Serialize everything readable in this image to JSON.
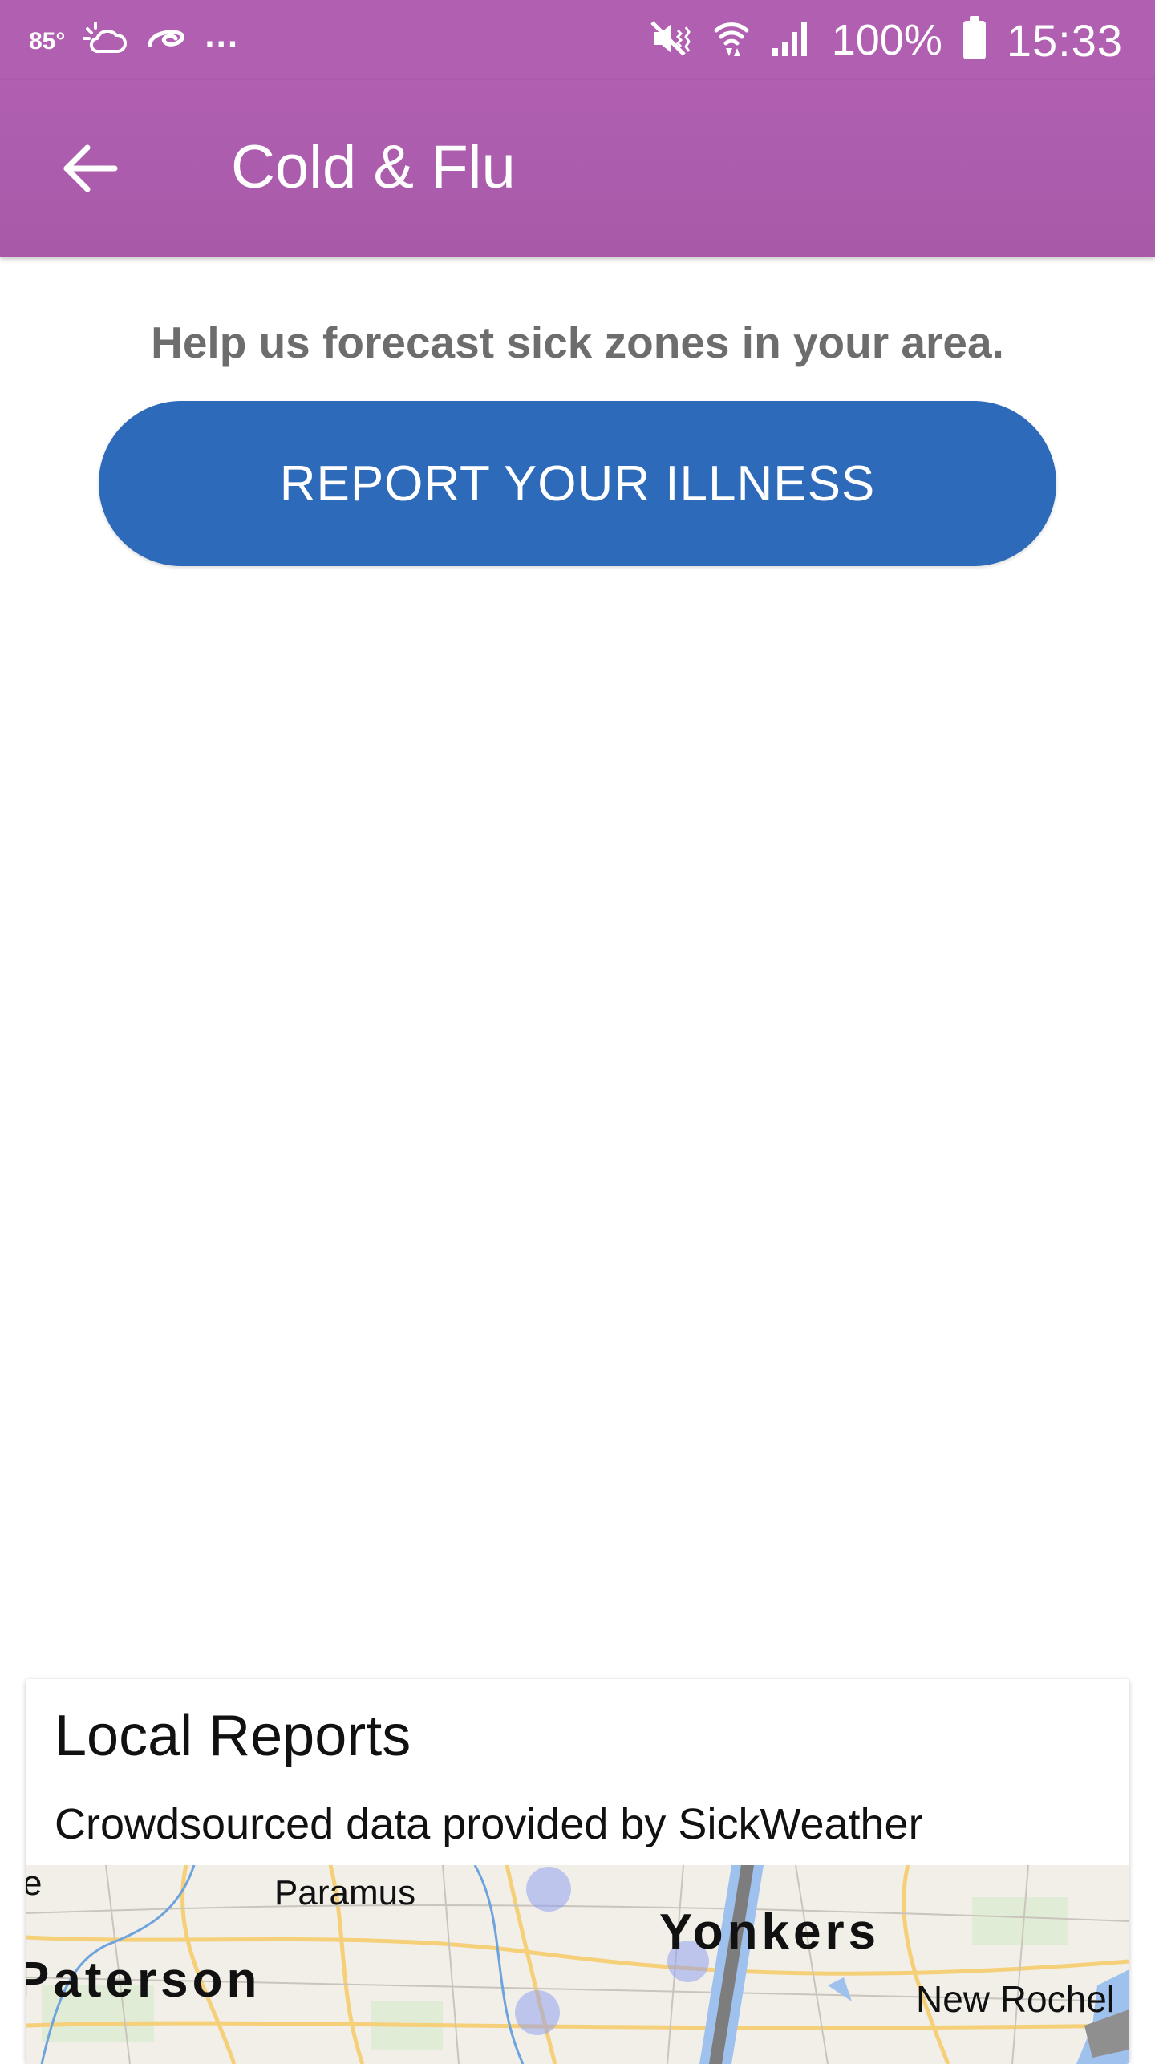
{
  "status_bar": {
    "temperature": "85°",
    "overflow": "...",
    "battery_percent": "100%",
    "time": "15:33",
    "icons": [
      "weather-icon",
      "swirl-notification-icon",
      "mute-icon",
      "wifi-icon",
      "signal-icon",
      "battery-icon"
    ]
  },
  "app_bar": {
    "title": "Cold & Flu",
    "back_icon": "arrow-back-icon",
    "background": "#b05fb1"
  },
  "main": {
    "help_text": "Help us forecast sick zones in your area.",
    "report_button_label": "REPORT YOUR ILLNESS",
    "report_button_color": "#2d6ab9"
  },
  "local_reports": {
    "title": "Local Reports",
    "subtitle": "Crowdsourced data provided by SickWeather",
    "map_labels": {
      "edge": "e",
      "paramus": "Paramus",
      "yonkers": "Yonkers",
      "paterson": "Paterson",
      "new_rochelle": "New Rochel"
    }
  }
}
